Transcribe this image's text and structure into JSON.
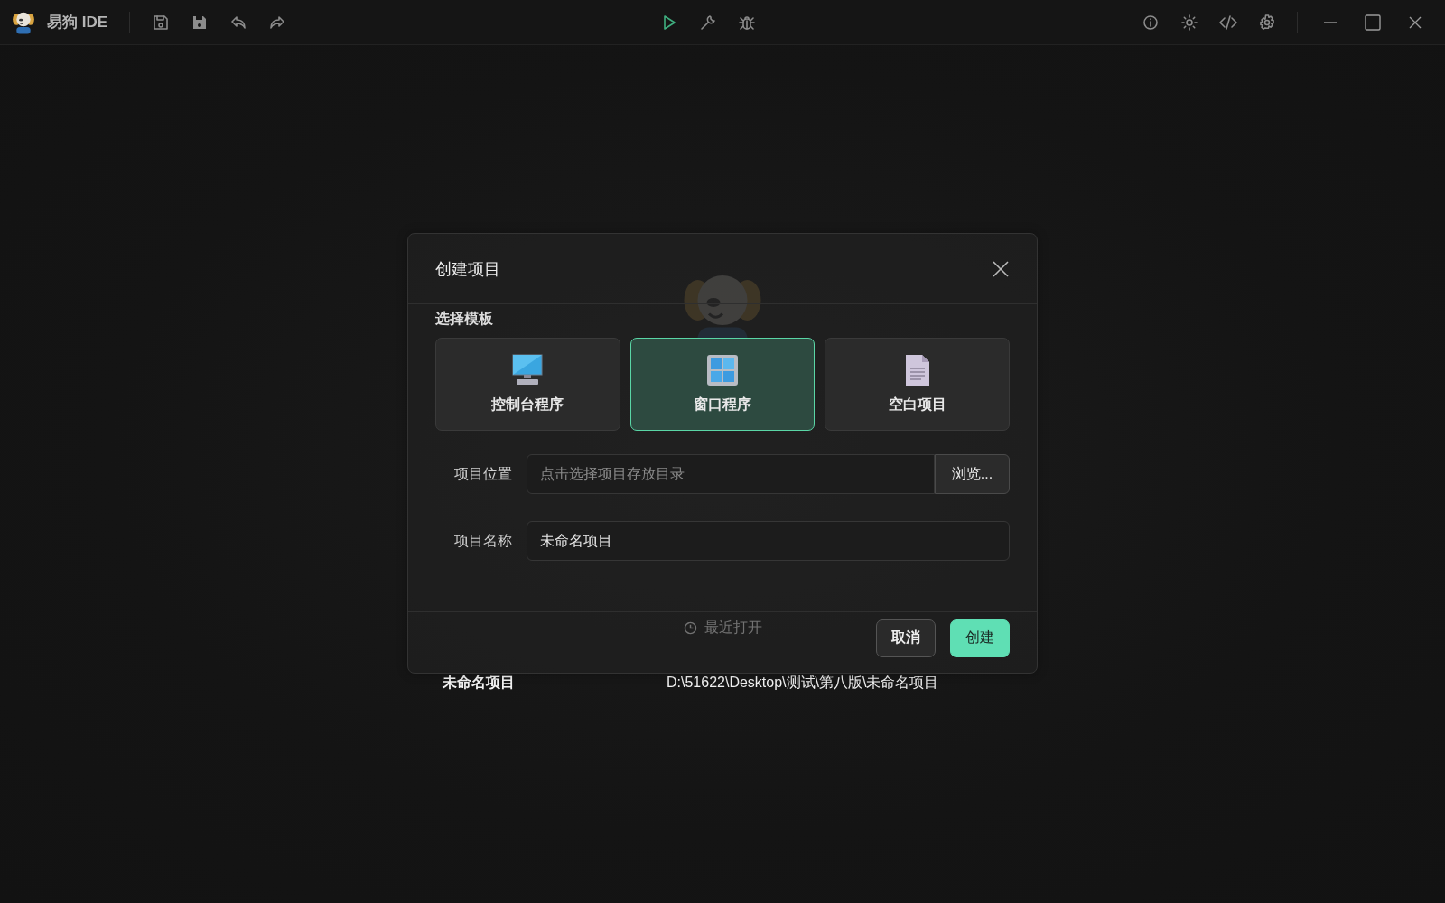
{
  "window": {
    "title": "易狗 IDE"
  },
  "welcome": {
    "recent_heading": "最近打开",
    "recent": [
      {
        "name": "未命名项目",
        "path": "D:\\51622\\Desktop\\测试\\第八版\\未命名项目"
      }
    ]
  },
  "dialog": {
    "title": "创建项目",
    "section_label": "选择模板",
    "templates": [
      {
        "kind": "console",
        "label": "控制台程序",
        "selected": false
      },
      {
        "kind": "window",
        "label": "窗口程序",
        "selected": true
      },
      {
        "kind": "blank",
        "label": "空白项目",
        "selected": false
      }
    ],
    "fields": [
      {
        "label": "项目位置",
        "placeholder": "点击选择项目存放目录",
        "button": "浏览..."
      },
      {
        "label": "项目名称",
        "value": "未命名项目"
      }
    ],
    "buttons": [
      {
        "kind": "secondary",
        "label": "取消"
      },
      {
        "kind": "primary",
        "label": "创建"
      }
    ]
  }
}
